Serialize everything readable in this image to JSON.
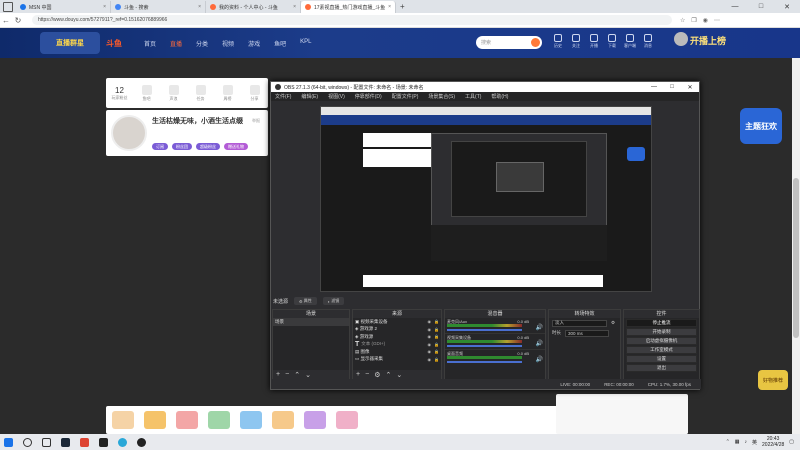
{
  "browser": {
    "tabs": [
      {
        "label": "MSN 中国",
        "color": "#1a73e8"
      },
      {
        "label": "斗鱼 - 搜索",
        "color": "#4285f4"
      },
      {
        "label": "我的资料 - 个人中心 - 斗鱼",
        "color": "#ff6a3a"
      },
      {
        "label": "17素视直播_热门游戏直播_斗鱼",
        "color": "#ff6a3a"
      }
    ],
    "url": "https://www.douyu.com/5727911?_ref=0.15162076889966"
  },
  "site": {
    "brand": "斗鱼",
    "banner_badge": "直播群星",
    "nav": [
      "首页",
      "直播",
      "分类",
      "视频",
      "游戏",
      "鱼吧",
      "KPL"
    ],
    "active_nav": "直播",
    "search_placeholder": "搜索",
    "header_icons": [
      "历史",
      "关注",
      "开播",
      "下载",
      "客户端",
      "消息"
    ],
    "live_button": "开播上榜"
  },
  "anchor_stats": [
    {
      "value": "12",
      "label": "玩家粉丝"
    },
    {
      "value": "",
      "label": "鱼吧"
    },
    {
      "value": "",
      "label": "声浪"
    },
    {
      "value": "",
      "label": "任务"
    },
    {
      "value": "",
      "label": "周榜"
    },
    {
      "value": "",
      "label": "分享"
    }
  ],
  "anchor": {
    "title": "生活枯燥无味，小酒生活点缀",
    "tag": "举报",
    "chips": [
      {
        "label": "订阅",
        "color": "#7b5cd6"
      },
      {
        "label": "粉丝团",
        "color": "#7b5cd6"
      },
      {
        "label": "超级粉丝",
        "color": "#7b5cd6"
      },
      {
        "label": "赠送礼物",
        "color": "#b35cd6"
      }
    ]
  },
  "obs": {
    "title": "OBS 27.1.3 (64-bit, windows) - 配置文件: 未命名 - 场景: 未命名",
    "menu": [
      "文件(F)",
      "编辑(E)",
      "视图(V)",
      "停靠部件(D)",
      "配置文件(P)",
      "场景集合(S)",
      "工具(T)",
      "帮助(H)"
    ],
    "no_source": "未选源",
    "props_btn": "属性",
    "filters_btn": "滤镜",
    "docks": {
      "scenes": {
        "title": "场景",
        "items": [
          "场景"
        ]
      },
      "sources": {
        "title": "来源",
        "items": [
          "视频采集设备",
          "游戏源 2",
          "游戏源",
          "文本 (GDI+)",
          "图像",
          "显示器采集"
        ]
      },
      "mixer": {
        "title": "混音器",
        "channels": [
          {
            "name": "麦克风/Aux",
            "value": "0.0 dB"
          },
          {
            "name": "视频采集设备",
            "value": "0.0 dB"
          },
          {
            "name": "桌面音频",
            "value": "0.0 dB"
          }
        ]
      },
      "transitions": {
        "title": "转场特效",
        "mode": "淡入",
        "duration_label": "时长",
        "duration": "300 ms"
      },
      "controls": {
        "title": "控件",
        "buttons": [
          "停止推流",
          "开始录制",
          "启动虚拟摄像机",
          "工作室模式",
          "设置",
          "退出"
        ]
      }
    },
    "status": {
      "live": "LIVE: 00:00:00",
      "rec": "REC: 00:00:00",
      "cpu": "CPU: 1.7%, 30.00 fps"
    }
  },
  "side": {
    "badge": "主题狂欢",
    "badge2": "好物推荐"
  },
  "taskbar": {
    "time": "20:43",
    "date": "2022/4/28",
    "lang": "英"
  }
}
